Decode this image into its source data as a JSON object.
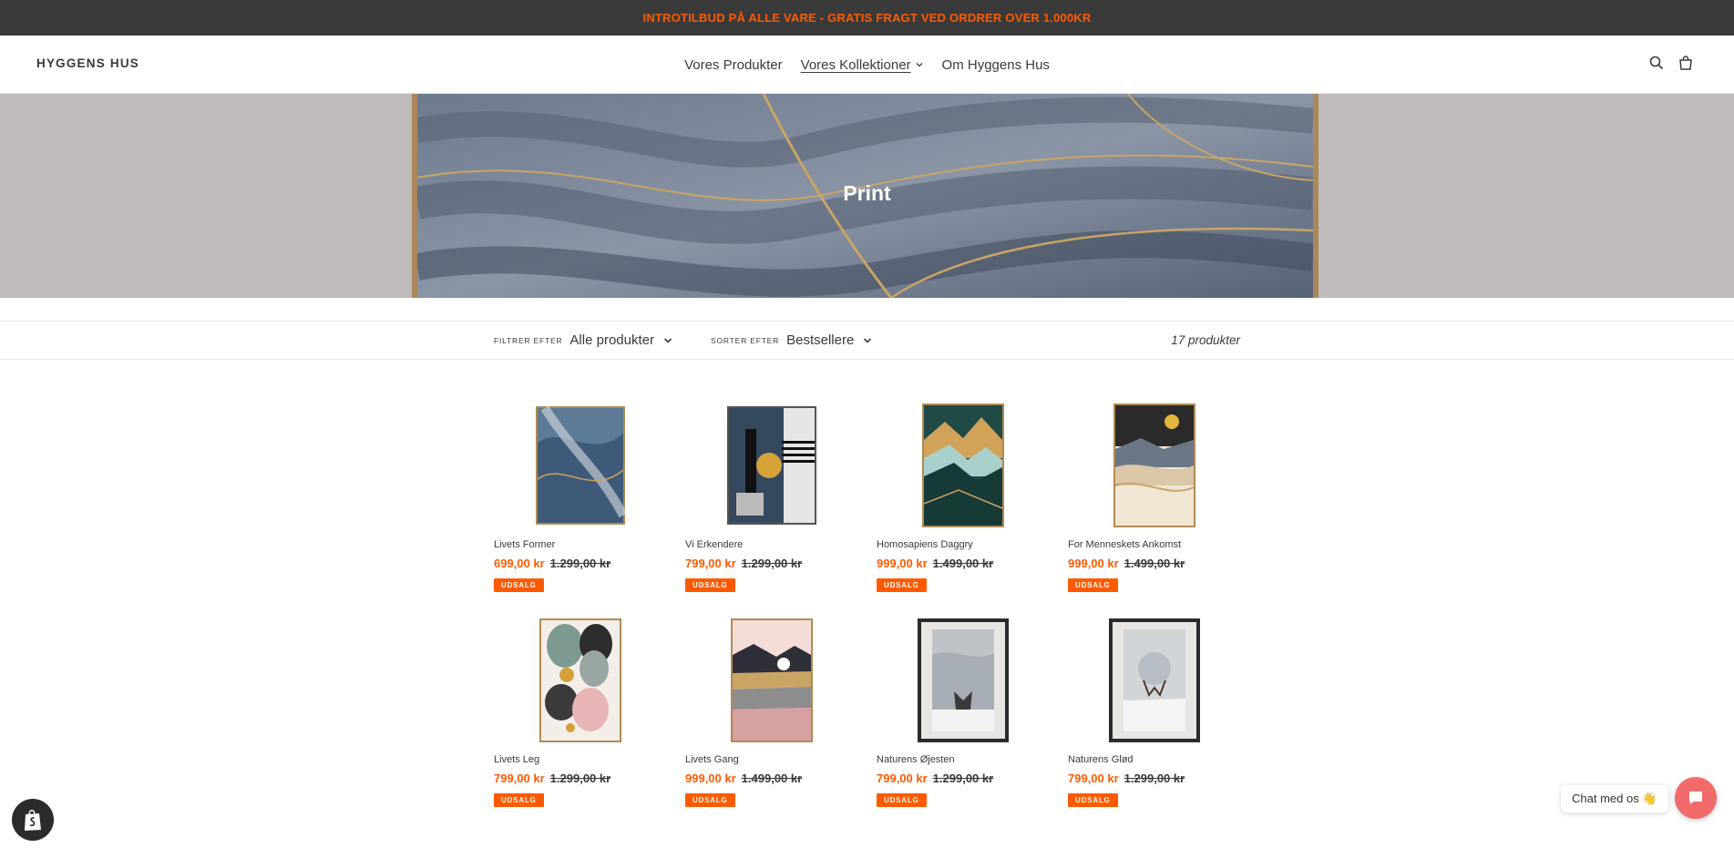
{
  "announcement": "INTROTILBUD PÅ ALLE VARE - GRATIS FRAGT VED ORDRER OVER 1.000KR",
  "header": {
    "logo": "HYGGENS HUS",
    "nav": [
      {
        "label": "Vores Produkter",
        "active": false
      },
      {
        "label": "Vores Kollektioner",
        "active": true,
        "dropdown": true
      },
      {
        "label": "Om Hyggens Hus",
        "active": false
      }
    ],
    "icons": [
      "search-icon",
      "cart-icon"
    ]
  },
  "hero": {
    "title": "Print"
  },
  "filters": {
    "filter_label": "FILTRER EFTER",
    "filter_value": "Alle produkter",
    "sort_label": "SORTER EFTER",
    "sort_value": "Bestsellere",
    "count": "17 produkter"
  },
  "products": [
    {
      "name": "Livets Former",
      "price": "699,00 kr",
      "old_price": "1.299,00 kr",
      "badge": "UDSALG"
    },
    {
      "name": "Vi Erkendere",
      "price": "799,00 kr",
      "old_price": "1.299,00 kr",
      "badge": "UDSALG"
    },
    {
      "name": "Homosapiens Daggry",
      "price": "999,00 kr",
      "old_price": "1.499,00 kr",
      "badge": "UDSALG"
    },
    {
      "name": "For Menneskets Ankomst",
      "price": "999,00 kr",
      "old_price": "1.499,00 kr",
      "badge": "UDSALG"
    },
    {
      "name": "Livets Leg",
      "price": "799,00 kr",
      "old_price": "1.299,00 kr",
      "badge": "UDSALG"
    },
    {
      "name": "Livets Gang",
      "price": "999,00 kr",
      "old_price": "1.499,00 kr",
      "badge": "UDSALG"
    },
    {
      "name": "Naturens Øjesten",
      "price": "799,00 kr",
      "old_price": "1.299,00 kr",
      "badge": "UDSALG"
    },
    {
      "name": "Naturens Glød",
      "price": "799,00 kr",
      "old_price": "1.299,00 kr",
      "badge": "UDSALG"
    }
  ],
  "chat": {
    "label": "Chat med os 👋"
  },
  "colors": {
    "accent": "#ff5a00",
    "dark_bar": "#3a3a3a",
    "hero_bg": "#c1bbbb",
    "chat": "#f26a6a"
  }
}
